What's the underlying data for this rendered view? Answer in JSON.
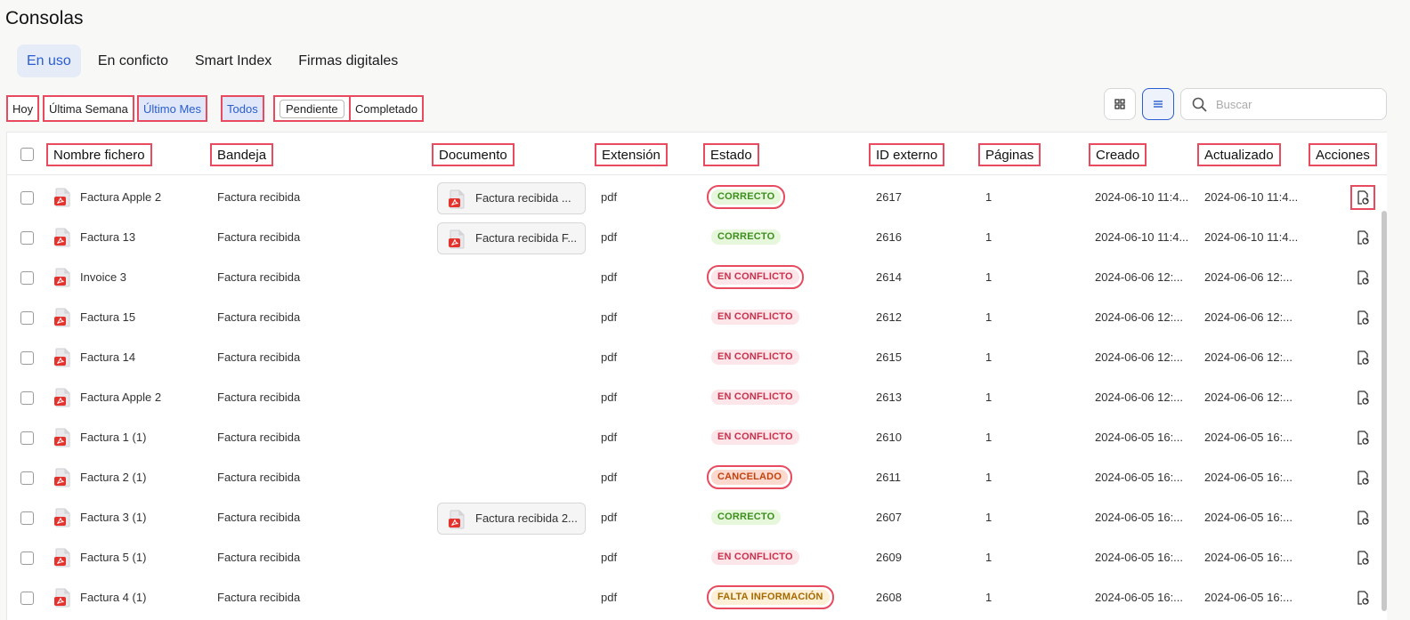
{
  "page": {
    "title": "Consolas"
  },
  "tabs": [
    {
      "label": "En uso",
      "active": true
    },
    {
      "label": "En conficto",
      "active": false
    },
    {
      "label": "Smart Index",
      "active": false
    },
    {
      "label": "Firmas digitales",
      "active": false
    }
  ],
  "date_filters": [
    "Hoy",
    "Última Semana",
    "Último Mes"
  ],
  "status_filters": [
    "Todos",
    "Pendiente",
    "Completado"
  ],
  "search": {
    "placeholder": "Buscar"
  },
  "columns": [
    "Nombre fichero",
    "Bandeja",
    "Documento",
    "Extensión",
    "Estado",
    "ID externo",
    "Páginas",
    "Creado",
    "Actualizado",
    "Acciones"
  ],
  "status_colors": {
    "CORRECTO": {
      "bg": "#e6f7dc",
      "fg": "#3e8e1f"
    },
    "EN CONFLICTO": {
      "bg": "#fde6ea",
      "fg": "#c9304c"
    },
    "CANCELADO": {
      "bg": "#fcd9cf",
      "fg": "#c2410c"
    },
    "FALTA INFORMACIÓN": {
      "bg": "#fdf0d6",
      "fg": "#a66a00"
    }
  },
  "rows": [
    {
      "name": "Factura Apple 2",
      "tray": "Factura recibida",
      "document": "Factura recibida ...",
      "ext": "pdf",
      "status": "CORRECTO",
      "ext_id": "2617",
      "pages": "1",
      "created": "2024-06-10 11:4...",
      "updated": "2024-06-10 11:4..."
    },
    {
      "name": "Factura 13",
      "tray": "Factura recibida",
      "document": "Factura recibida F...",
      "ext": "pdf",
      "status": "CORRECTO",
      "ext_id": "2616",
      "pages": "1",
      "created": "2024-06-10 11:4...",
      "updated": "2024-06-10 11:4..."
    },
    {
      "name": "Invoice 3",
      "tray": "Factura recibida",
      "document": "",
      "ext": "pdf",
      "status": "EN CONFLICTO",
      "ext_id": "2614",
      "pages": "1",
      "created": "2024-06-06 12:...",
      "updated": "2024-06-06 12:..."
    },
    {
      "name": "Factura 15",
      "tray": "Factura recibida",
      "document": "",
      "ext": "pdf",
      "status": "EN CONFLICTO",
      "ext_id": "2612",
      "pages": "1",
      "created": "2024-06-06 12:...",
      "updated": "2024-06-06 12:..."
    },
    {
      "name": "Factura 14",
      "tray": "Factura recibida",
      "document": "",
      "ext": "pdf",
      "status": "EN CONFLICTO",
      "ext_id": "2615",
      "pages": "1",
      "created": "2024-06-06 12:...",
      "updated": "2024-06-06 12:..."
    },
    {
      "name": "Factura Apple 2",
      "tray": "Factura recibida",
      "document": "",
      "ext": "pdf",
      "status": "EN CONFLICTO",
      "ext_id": "2613",
      "pages": "1",
      "created": "2024-06-06 12:...",
      "updated": "2024-06-06 12:..."
    },
    {
      "name": "Factura 1 (1)",
      "tray": "Factura recibida",
      "document": "",
      "ext": "pdf",
      "status": "EN CONFLICTO",
      "ext_id": "2610",
      "pages": "1",
      "created": "2024-06-05 16:...",
      "updated": "2024-06-05 16:..."
    },
    {
      "name": "Factura 2 (1)",
      "tray": "Factura recibida",
      "document": "",
      "ext": "pdf",
      "status": "CANCELADO",
      "ext_id": "2611",
      "pages": "1",
      "created": "2024-06-05 16:...",
      "updated": "2024-06-05 16:..."
    },
    {
      "name": "Factura 3 (1)",
      "tray": "Factura recibida",
      "document": "Factura recibida 2...",
      "ext": "pdf",
      "status": "CORRECTO",
      "ext_id": "2607",
      "pages": "1",
      "created": "2024-06-05 16:...",
      "updated": "2024-06-05 16:..."
    },
    {
      "name": "Factura 5 (1)",
      "tray": "Factura recibida",
      "document": "",
      "ext": "pdf",
      "status": "EN CONFLICTO",
      "ext_id": "2609",
      "pages": "1",
      "created": "2024-06-05 16:...",
      "updated": "2024-06-05 16:..."
    },
    {
      "name": "Factura 4 (1)",
      "tray": "Factura recibida",
      "document": "",
      "ext": "pdf",
      "status": "FALTA INFORMACIÓN",
      "ext_id": "2608",
      "pages": "1",
      "created": "2024-06-05 16:...",
      "updated": "2024-06-05 16:..."
    }
  ]
}
